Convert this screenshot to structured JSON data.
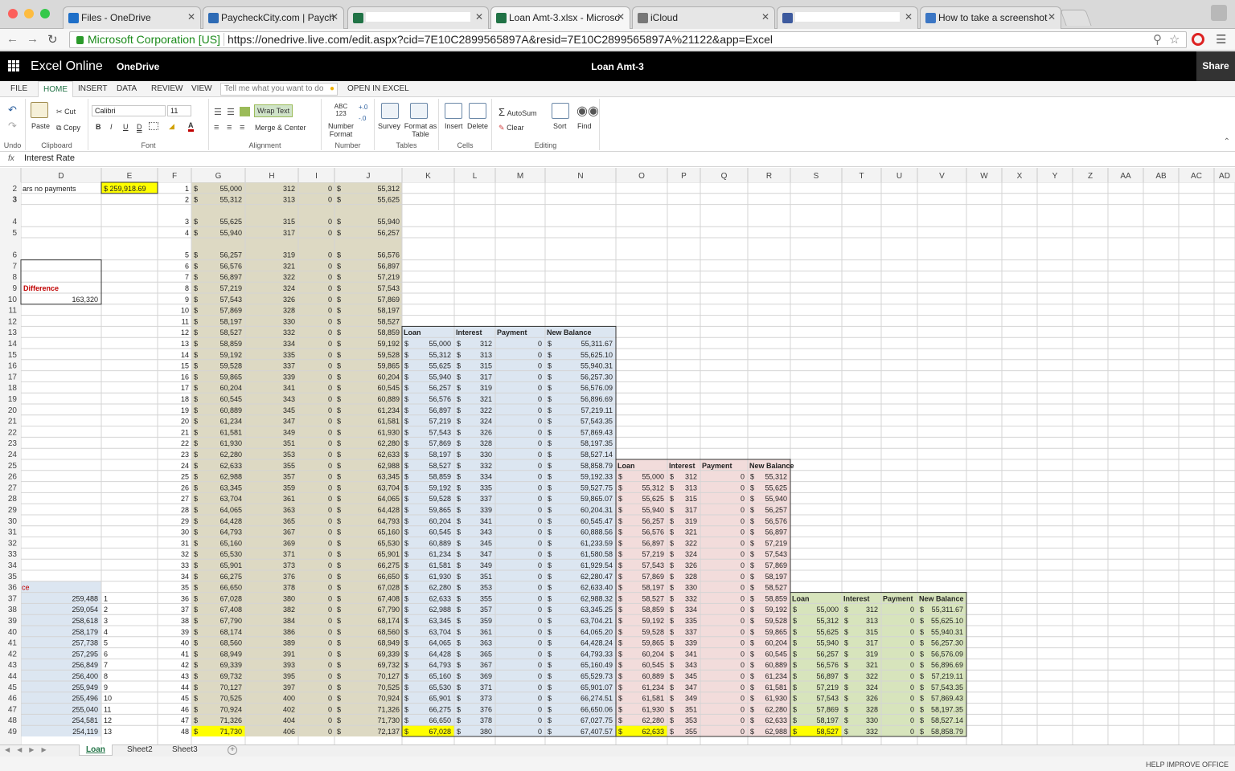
{
  "browser": {
    "tabs": [
      {
        "title": "Files - OneDrive",
        "color": "#1e6fc8"
      },
      {
        "title": "PaycheckCity.com | Paych",
        "color": "#2e6bb5"
      },
      {
        "title": "",
        "color": "#217346"
      },
      {
        "title": "Loan Amt-3.xlsx - Microso",
        "color": "#217346"
      },
      {
        "title": "iCloud",
        "color": "#777777"
      },
      {
        "title": "",
        "color": "#3d5a9e"
      },
      {
        "title": "How to take a screenshot",
        "color": "#3b76c4"
      }
    ],
    "active_tab": 3,
    "ev_label": "Microsoft Corporation [US]",
    "url": "https://onedrive.live.com/edit.aspx?cid=7E10C2899565897A&resid=7E10C2899565897A%21122&app=Excel"
  },
  "app": {
    "name": "Excel Online",
    "breadcrumb": "OneDrive",
    "doc_title": "Loan Amt-3",
    "share_label": "Share"
  },
  "ribbon": {
    "tabs": [
      "FILE",
      "HOME",
      "INSERT",
      "DATA",
      "REVIEW",
      "VIEW"
    ],
    "active": "HOME",
    "tell_me": "Tell me what you want to do",
    "open_in_excel": "OPEN IN EXCEL",
    "groups": {
      "undo": "Undo",
      "clipboard": "Clipboard",
      "font": "Font",
      "alignment": "Alignment",
      "number": "Number",
      "tables": "Tables",
      "cells": "Cells",
      "editing": "Editing"
    },
    "cut": "Cut",
    "copy": "Copy",
    "paste": "Paste",
    "font_name": "Calibri",
    "font_size": "11",
    "bold": "B",
    "italic": "I",
    "underline": "U",
    "double_underline": "D",
    "wrap_text": "Wrap Text",
    "merge_center": "Merge & Center",
    "number_glyph": "ABC 123",
    "number_format": "Number Format",
    "survey": "Survey",
    "format_table": "Format as Table",
    "insert": "Insert",
    "delete": "Delete",
    "autosum": "AutoSum",
    "clear": "Clear",
    "sort": "Sort",
    "find": "Find"
  },
  "formula_bar": {
    "fx": "fx",
    "content": "Interest Rate"
  },
  "grid": {
    "col_headers": [
      "D",
      "E",
      "F",
      "G",
      "H",
      "I",
      "J",
      "K",
      "L",
      "M",
      "N",
      "O",
      "P",
      "Q",
      "R",
      "S",
      "T",
      "U",
      "V",
      "W",
      "X",
      "Y",
      "Z",
      "AA",
      "AB",
      "AC",
      "AD"
    ],
    "row_numbers": [
      "2",
      "3",
      "4",
      "5",
      "6",
      "7",
      "8",
      "9",
      "10",
      "11",
      "12",
      "13",
      "14",
      "15",
      "16",
      "17",
      "18",
      "19",
      "20",
      "21",
      "22",
      "23",
      "24",
      "25",
      "26",
      "27",
      "28",
      "29",
      "30",
      "31",
      "32",
      "33",
      "34",
      "35",
      "36",
      "37",
      "38",
      "39",
      "40",
      "41",
      "42",
      "43",
      "44",
      "45",
      "46",
      "47",
      "48",
      "49"
    ],
    "d_texts": {
      "row2": "ars no payments",
      "row9": "Difference",
      "row10": "163,320",
      "row36": "ce"
    },
    "e2": "$      259,918.69",
    "main_table": {
      "f": [
        "1",
        "2",
        "3",
        "4",
        "5",
        "6",
        "7",
        "8",
        "9",
        "10",
        "11",
        "12",
        "13",
        "14",
        "15",
        "16",
        "17",
        "18",
        "19",
        "20",
        "21",
        "22",
        "23",
        "24",
        "25",
        "26",
        "27",
        "28",
        "29",
        "30",
        "31",
        "32",
        "33",
        "34",
        "35",
        "36",
        "37",
        "38",
        "39",
        "40",
        "41",
        "42",
        "43",
        "44",
        "45",
        "46",
        "47",
        "48"
      ],
      "g": [
        "55,000",
        "55,312",
        "55,625",
        "55,940",
        "56,257",
        "56,576",
        "56,897",
        "57,219",
        "57,543",
        "57,869",
        "58,197",
        "58,527",
        "58,859",
        "59,192",
        "59,528",
        "59,865",
        "60,204",
        "60,545",
        "60,889",
        "61,234",
        "61,581",
        "61,930",
        "62,280",
        "62,633",
        "62,988",
        "63,345",
        "63,704",
        "64,065",
        "64,428",
        "64,793",
        "65,160",
        "65,530",
        "65,901",
        "66,275",
        "66,650",
        "67,028",
        "67,408",
        "67,790",
        "68,174",
        "68,560",
        "68,949",
        "69,339",
        "69,732",
        "70,127",
        "70,525",
        "70,924",
        "71,326",
        "71,730"
      ],
      "h": [
        "312",
        "313",
        "315",
        "317",
        "319",
        "321",
        "322",
        "324",
        "326",
        "328",
        "330",
        "332",
        "334",
        "335",
        "337",
        "339",
        "341",
        "343",
        "345",
        "347",
        "349",
        "351",
        "353",
        "355",
        "357",
        "359",
        "361",
        "363",
        "365",
        "367",
        "369",
        "371",
        "373",
        "376",
        "378",
        "380",
        "382",
        "384",
        "386",
        "389",
        "391",
        "393",
        "395",
        "397",
        "400",
        "402",
        "404",
        "406"
      ],
      "j": [
        "55,312",
        "55,625",
        "55,940",
        "56,257",
        "56,576",
        "56,897",
        "57,219",
        "57,543",
        "57,869",
        "58,197",
        "58,527",
        "58,859",
        "59,192",
        "59,528",
        "59,865",
        "60,204",
        "60,545",
        "60,889",
        "61,234",
        "61,581",
        "61,930",
        "62,280",
        "62,633",
        "62,988",
        "63,345",
        "63,704",
        "64,065",
        "64,428",
        "64,793",
        "65,160",
        "65,530",
        "65,901",
        "66,275",
        "66,650",
        "67,028",
        "67,408",
        "67,790",
        "68,174",
        "68,560",
        "68,949",
        "69,339",
        "69,732",
        "70,127",
        "70,525",
        "70,924",
        "71,326",
        "71,730",
        "72,137"
      ]
    },
    "col_d_values": [
      "259,488",
      "259,054",
      "258,618",
      "258,179",
      "257,738",
      "257,295",
      "256,849",
      "256,400",
      "255,949",
      "255,496",
      "255,040",
      "254,581",
      "254,119"
    ],
    "col_e_values": [
      "1",
      "2",
      "3",
      "4",
      "5",
      "6",
      "7",
      "8",
      "9",
      "10",
      "11",
      "12",
      "13"
    ],
    "blue_table": {
      "headers": [
        "Loan",
        "Interest",
        "Payment",
        "New Balance"
      ],
      "loan": [
        "55,000",
        "55,312",
        "55,625",
        "55,940",
        "56,257",
        "56,576",
        "56,897",
        "57,219",
        "57,543",
        "57,869",
        "58,197",
        "58,527",
        "58,859",
        "59,192",
        "59,528",
        "59,865",
        "60,204",
        "60,545",
        "60,889",
        "61,234",
        "61,581",
        "61,930",
        "62,280",
        "62,633",
        "62,988",
        "63,345",
        "63,704",
        "64,065",
        "64,428",
        "64,793",
        "65,160",
        "65,530",
        "65,901",
        "66,275",
        "66,650",
        "67,028"
      ],
      "interest": [
        "312",
        "313",
        "315",
        "317",
        "319",
        "321",
        "322",
        "324",
        "326",
        "328",
        "330",
        "332",
        "334",
        "335",
        "337",
        "339",
        "341",
        "343",
        "345",
        "347",
        "349",
        "351",
        "353",
        "355",
        "357",
        "359",
        "361",
        "363",
        "365",
        "367",
        "369",
        "371",
        "373",
        "376",
        "378",
        "380"
      ],
      "balance": [
        "55,311.67",
        "55,625.10",
        "55,940.31",
        "56,257.30",
        "56,576.09",
        "56,896.69",
        "57,219.11",
        "57,543.35",
        "57,869.43",
        "58,197.35",
        "58,527.14",
        "58,858.79",
        "59,192.33",
        "59,527.75",
        "59,865.07",
        "60,204.31",
        "60,545.47",
        "60,888.56",
        "61,233.59",
        "61,580.58",
        "61,929.54",
        "62,280.47",
        "62,633.40",
        "62,988.32",
        "63,345.25",
        "63,704.21",
        "64,065.20",
        "64,428.24",
        "64,793.33",
        "65,160.49",
        "65,529.73",
        "65,901.07",
        "66,274.51",
        "66,650.06",
        "67,027.75",
        "67,407.57"
      ]
    },
    "pink_table": {
      "headers": [
        "Loan",
        "Interest",
        "Payment",
        "New Balance"
      ],
      "loan": [
        "55,000",
        "55,312",
        "55,625",
        "55,940",
        "56,257",
        "56,576",
        "56,897",
        "57,219",
        "57,543",
        "57,869",
        "58,197",
        "58,527",
        "58,859",
        "59,192",
        "59,528",
        "59,865",
        "60,204",
        "60,545",
        "60,889",
        "61,234",
        "61,581",
        "61,930",
        "62,280",
        "62,633"
      ],
      "interest": [
        "312",
        "313",
        "315",
        "317",
        "319",
        "321",
        "322",
        "324",
        "326",
        "328",
        "330",
        "332",
        "334",
        "335",
        "337",
        "339",
        "341",
        "343",
        "345",
        "347",
        "349",
        "351",
        "353",
        "355"
      ],
      "balance": [
        "55,312",
        "55,625",
        "55,940",
        "56,257",
        "56,576",
        "56,897",
        "57,219",
        "57,543",
        "57,869",
        "58,197",
        "58,527",
        "58,859",
        "59,192",
        "59,528",
        "59,865",
        "60,204",
        "60,545",
        "60,889",
        "61,234",
        "61,581",
        "61,930",
        "62,280",
        "62,633",
        "62,988"
      ]
    },
    "green_table": {
      "headers": [
        "Loan",
        "Interest",
        "Payment",
        "New Balance"
      ],
      "loan": [
        "55,000",
        "55,312",
        "55,625",
        "55,940",
        "56,257",
        "56,576",
        "56,897",
        "57,219",
        "57,543",
        "57,869",
        "58,197",
        "58,527"
      ],
      "interest": [
        "312",
        "313",
        "315",
        "317",
        "319",
        "321",
        "322",
        "324",
        "326",
        "328",
        "330",
        "332"
      ],
      "balance": [
        "55,311.67",
        "55,625.10",
        "55,940.31",
        "56,257.30",
        "56,576.09",
        "56,896.69",
        "57,219.11",
        "57,543.35",
        "57,869.43",
        "58,197.35",
        "58,527.14",
        "58,858.79"
      ]
    },
    "zero": "0",
    "dollar": "$"
  },
  "sheets": {
    "tabs": [
      "Loan",
      "Sheet2",
      "Sheet3"
    ],
    "active": "Loan"
  },
  "status": {
    "help": "HELP IMPROVE OFFICE"
  },
  "colors": {
    "accent": "#217346",
    "tan": "#ddd9c3",
    "blue": "#dce6f1",
    "pink": "#f2dcdb",
    "green": "#d7e4bc",
    "yellow": "#ffff00",
    "red": "#c00000"
  }
}
